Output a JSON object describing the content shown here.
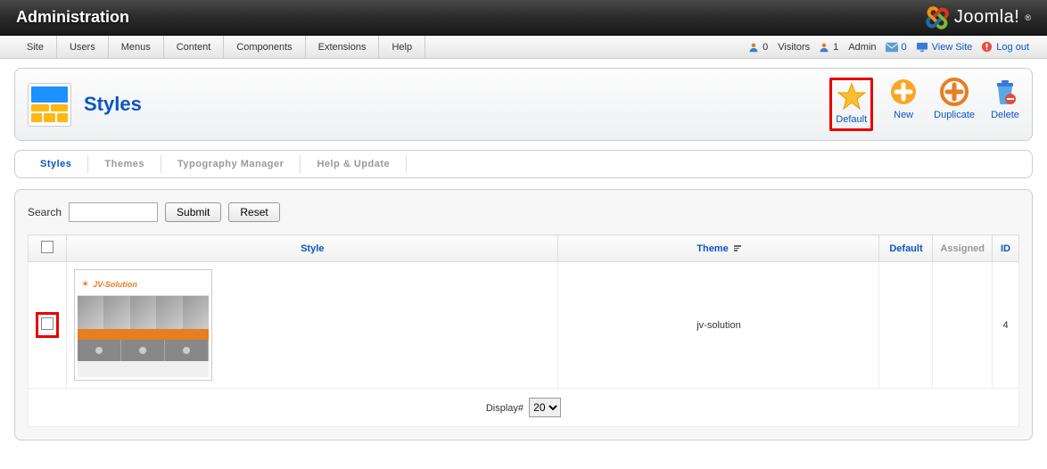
{
  "topbar": {
    "title": "Administration",
    "brand": "Joomla!"
  },
  "menu": {
    "items": [
      "Site",
      "Users",
      "Menus",
      "Content",
      "Components",
      "Extensions",
      "Help"
    ]
  },
  "status": {
    "visitors": {
      "count": "0",
      "label": "Visitors"
    },
    "admins": {
      "count": "1",
      "label": "Admin"
    },
    "messages": "0",
    "view_site": "View Site",
    "logout": "Log out"
  },
  "header": {
    "title": "Styles"
  },
  "toolbar": {
    "default": "Default",
    "new": "New",
    "duplicate": "Duplicate",
    "delete": "Delete"
  },
  "submenu": {
    "styles": "Styles",
    "themes": "Themes",
    "typography": "Typography Manager",
    "help": "Help & Update"
  },
  "search": {
    "label": "Search",
    "submit": "Submit",
    "reset": "Reset",
    "value": ""
  },
  "table": {
    "headers": {
      "style": "Style",
      "theme": "Theme",
      "default": "Default",
      "assigned": "Assigned",
      "id": "ID"
    },
    "rows": [
      {
        "thumb_title": "JV-Solution",
        "theme": "jv-solution",
        "default": "",
        "assigned": "",
        "id": "4"
      }
    ],
    "display_label": "Display#",
    "display_value": "20"
  }
}
